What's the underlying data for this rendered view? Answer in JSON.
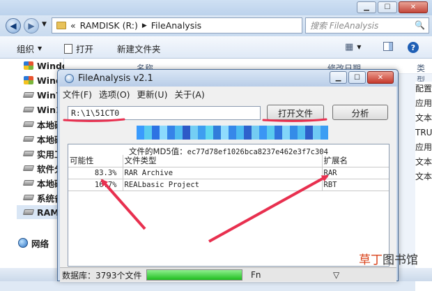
{
  "explorer": {
    "address_back_text": "«",
    "address_path": [
      "RAMDISK (R:)",
      "FileAnalysis"
    ],
    "search_placeholder": "搜索 FileAnalysis",
    "toolbar": {
      "organize": "组织",
      "open": "打开",
      "new_folder": "新建文件夹"
    },
    "nav_items": [
      "Windows 7 (C:)",
      "Wind",
      "Win7",
      "Win1",
      "本地磁",
      "本地磁",
      "实用工",
      "软件分",
      "本地磁",
      "系统备",
      "RAM"
    ],
    "network": "网络",
    "columns": {
      "name": "名称",
      "modified": "修改日期",
      "type": "类型"
    },
    "right_col": [
      "配置",
      "应用",
      "文本",
      "TRU",
      "应用",
      "文本",
      "文本"
    ]
  },
  "dialog": {
    "title": "FileAnalysis v2.1",
    "menu": [
      "文件(F)",
      "选项(O)",
      "更新(U)",
      "关于(A)"
    ],
    "path_value": "R:\\1\\51CT0",
    "open_button": "打开文件",
    "analyze_button": "分析",
    "md5_label": "文件的MD5值：",
    "md5_value": "ec77d78ef1026bca8237e462e3f7c304",
    "headers": {
      "probability": "可能性",
      "file_type": "文件类型",
      "extension": "扩展名"
    },
    "rows": [
      {
        "probability": "83.3%",
        "file_type": "RAR Archive",
        "extension": "RAR"
      },
      {
        "probability": "16.7%",
        "file_type": "REALbasic Project",
        "extension": "RBT"
      }
    ],
    "status": {
      "database": "数据库：3793个文件",
      "fn": "Fn"
    },
    "progress_fraction": 1.0
  },
  "watermark": {
    "part1": "草丁",
    "part2": "图书馆"
  },
  "colors": {
    "annotation": "#e8304f",
    "progress": "#1fbd1f",
    "blur": [
      "#1a8cff",
      "#3ec4f0",
      "#0a5de0",
      "#7ad6ff",
      "#1570e6",
      "#32b2ef",
      "#0b3fbf",
      "#5ec8f5",
      "#1f8ff0",
      "#43d1f0",
      "#0f68d6",
      "#7fd8ff",
      "#1575e8",
      "#2fb0f0",
      "#0c49c6",
      "#5ec4f2",
      "#1a86f5",
      "#3fc3ef",
      "#0f5fd8",
      "#6fd0fa",
      "#137ae6",
      "#36b5ef",
      "#0c45c2",
      "#58c1f4",
      "#1c8ef3"
    ]
  }
}
